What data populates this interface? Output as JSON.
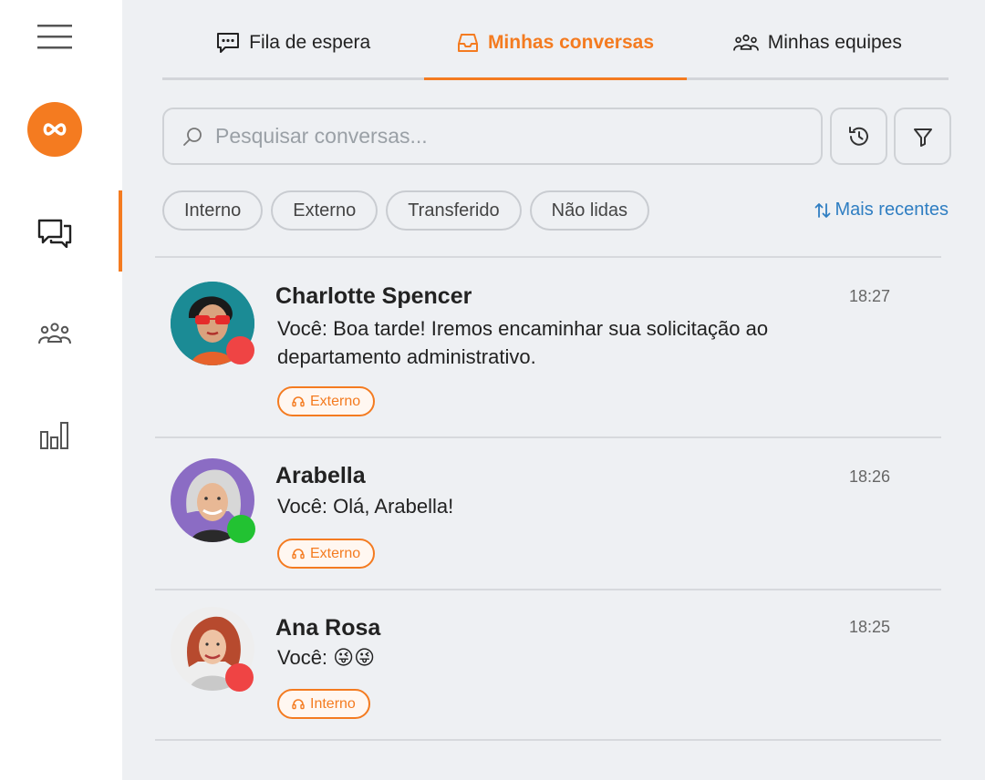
{
  "colors": {
    "accent": "#f47b20",
    "link": "#2f7ec2",
    "online": "#22c232",
    "busy": "#ef4444"
  },
  "tabs": [
    {
      "label": "Fila de espera",
      "icon": "chat-dots-icon"
    },
    {
      "label": "Minhas conversas",
      "icon": "inbox-icon",
      "active": true
    },
    {
      "label": "Minhas equipes",
      "icon": "team-icon"
    }
  ],
  "search": {
    "placeholder": "Pesquisar conversas..."
  },
  "filters": [
    "Interno",
    "Externo",
    "Transferido",
    "Não lidas"
  ],
  "sort": {
    "label": "Mais recentes"
  },
  "conversations": [
    {
      "name": "Charlotte Spencer",
      "time": "18:27",
      "message": "Você: Boa tarde! Iremos encaminhar sua solicitação ao departamento administrativo.",
      "tag": "Externo",
      "status": "busy"
    },
    {
      "name": "Arabella",
      "time": "18:26",
      "message": "Você: Olá, Arabella!",
      "tag": "Externo",
      "status": "online"
    },
    {
      "name": "Ana Rosa",
      "time": "18:25",
      "message": "Você: 😜😜",
      "tag": "Interno",
      "status": "busy"
    }
  ]
}
